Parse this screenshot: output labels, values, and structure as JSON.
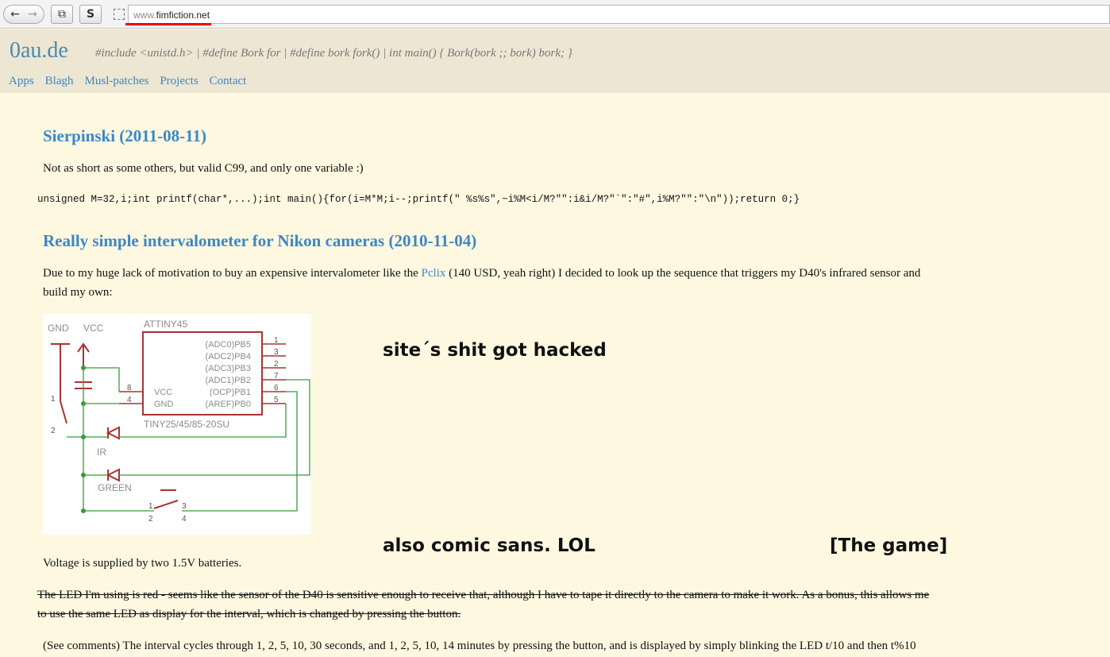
{
  "browser": {
    "back_glyph": "←",
    "forward_glyph": "→",
    "copy_glyph": "⧉",
    "s_label": "S",
    "url_prefix": "www.",
    "url_domain": "fimfiction.net",
    "accent_mark_color": "#e00000"
  },
  "site": {
    "logo": "0au.de",
    "tagline": "#include <unistd.h> | #define Bork for | #define bork fork() | int main() { Bork(bork ;; bork) bork; }",
    "nav": [
      "Apps",
      "Blagh",
      "Musl-patches",
      "Projects",
      "Contact"
    ],
    "link_color": "#3b87c6"
  },
  "posts": {
    "p1_title": "Sierpinski (2011-08-11)",
    "p1_text": "Not as short as some others, but valid C99, and only one variable :)",
    "p1_code": "unsigned M=32,i;int printf(char*,...);int main(){for(i=M*M;i--;printf(\" %s%s\",~i%M<i/M?\"\":i&i/M?\"`\":\"#\",i%M?\"\":\"\\n\"));return 0;}",
    "p2_title": "Really simple intervalometer for Nikon cameras (2010-11-04)",
    "p2_intro_before": "Due to my huge lack of motivation to buy an expensive intervalometer like the ",
    "p2_intro_link": "Pclix",
    "p2_intro_after": " (140 USD, yeah right) I decided to look up the sequence that triggers my D40's infrared sensor and build my own:",
    "voltage": "Voltage is supplied by two 1.5V batteries.",
    "struck": "The LED I'm using is red - seems like the sensor of the D40 is sensitive enough to receive that, although I have to tape it directly to the camera to make it work. As a bonus, this allows me to use the same LED as display for the interval, which is changed by pressing the button.",
    "comments": "(See comments) The interval cycles through 1, 2, 5, 10, 30 seconds, and 1, 2, 5, 10, 14 minutes by pressing the button, and is displayed by simply blinking the LED t/10 and then t%10"
  },
  "schematic": {
    "gnd": "GND",
    "vcc": "VCC",
    "chip": "ATTINY45",
    "chip_part": "TINY25/45/85-20SU",
    "pins_right": [
      "(ADC0)PB5",
      "(ADC2)PB4",
      "(ADC3)PB3",
      "(ADC1)PB2",
      "(OCP)PB1",
      "(AREF)PB0"
    ],
    "pin_nums_right": [
      "1",
      "3",
      "2",
      "7",
      "6",
      "5"
    ],
    "pins_left": [
      "VCC",
      "GND"
    ],
    "pin_nums_left": [
      "8",
      "4"
    ],
    "led1": "IR",
    "led2": "GREEN",
    "switch_pins": [
      "1",
      "2",
      "3",
      "4"
    ],
    "switch_side": [
      "1",
      "2"
    ]
  },
  "overlays": {
    "hacked": "site´s shit got hacked",
    "comic": "also comic sans. LOL",
    "game": "[The game]"
  }
}
